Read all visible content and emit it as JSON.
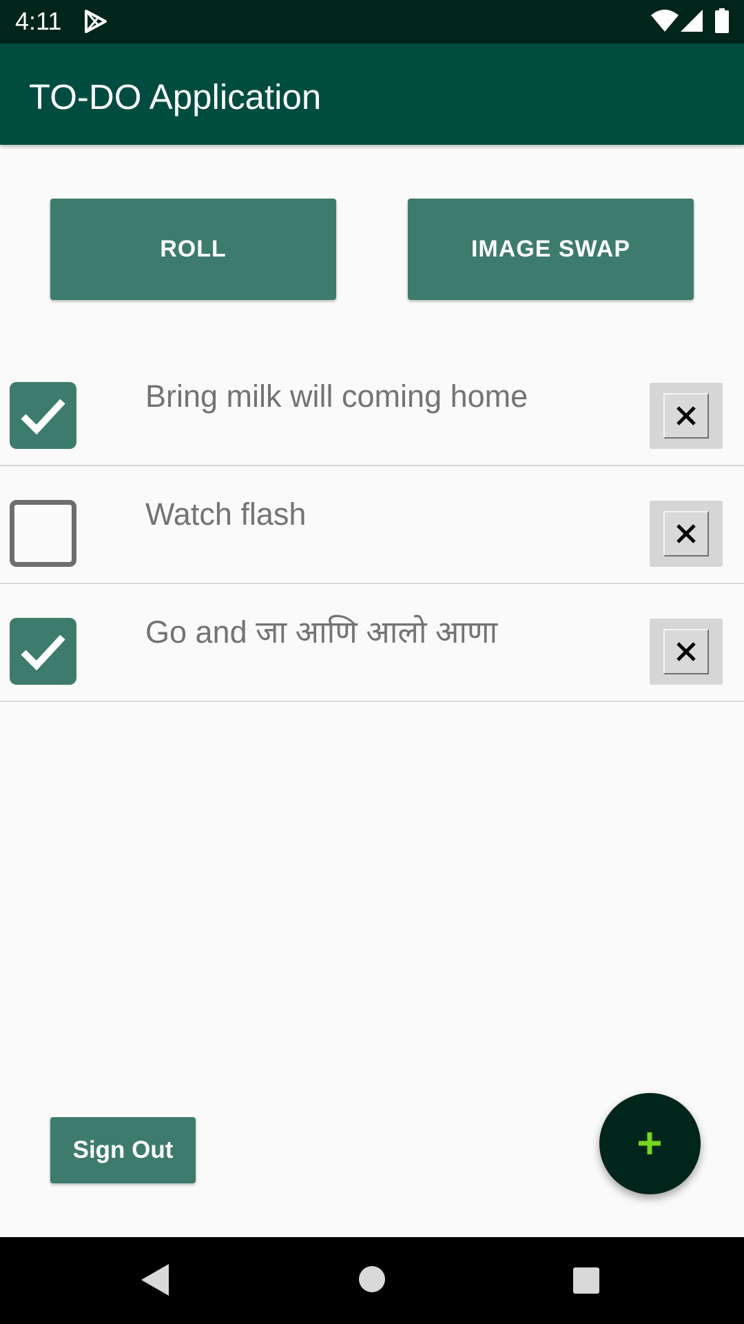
{
  "status_bar": {
    "time": "4:11",
    "icons": [
      "play-store-icon",
      "wifi-icon",
      "signal-icon",
      "battery-icon"
    ]
  },
  "app_bar": {
    "title": "TO-DO Application"
  },
  "actions": {
    "roll_label": "ROLL",
    "image_swap_label": "IMAGE SWAP"
  },
  "todos": [
    {
      "text": "Bring milk will coming home",
      "checked": true
    },
    {
      "text": "Watch flash",
      "checked": false
    },
    {
      "text": "Go and जा आणि आलो आणा",
      "checked": true
    }
  ],
  "sign_out_label": "Sign Out",
  "fab": {
    "icon": "plus-icon"
  },
  "colors": {
    "status_bar": "#00251a",
    "app_bar": "#004d40",
    "accent": "#3d7b6c",
    "fab": "#00251a",
    "fab_icon": "#76d420",
    "text_secondary": "#737373"
  },
  "nav_bar": {
    "icons": [
      "back-icon",
      "home-icon",
      "recents-icon"
    ]
  }
}
